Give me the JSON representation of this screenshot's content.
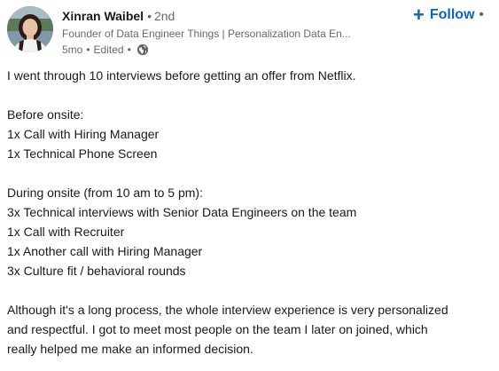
{
  "author": {
    "name": "Xinran Waibel",
    "degree": "2nd",
    "headline": "Founder of Data Engineer Things | Personalization Data En...",
    "time": "5mo",
    "edited": "Edited",
    "visibility_icon": "globe-icon",
    "avatar_icon": "profile-photo"
  },
  "actions": {
    "follow_label": "Follow",
    "follow_icon": "plus-icon",
    "more_icon": "overflow-menu-icon"
  },
  "colors": {
    "accent": "#0a66c2",
    "text_primary": "#1f1f1f",
    "text_secondary": "#666666"
  },
  "post": {
    "line1": "I went through 10 interviews before getting an offer from Netflix.",
    "line2": "Before onsite:",
    "line3": "1x Call with Hiring Manager",
    "line4": "1x Technical Phone Screen",
    "line5": "During onsite (from 10 am to 5 pm):",
    "line6": "3x Technical interviews with Senior Data Engineers on the team",
    "line7": "1x Call with Recruiter",
    "line8": "1x Another call with Hiring Manager",
    "line9": "3x Culture fit / behavioral rounds",
    "line10": "Although it's a long process, the whole interview experience is very personalized",
    "line11": "and respectful. I got to meet most people on the team I later on joined, which",
    "line12": "really helped me make an informed decision."
  }
}
